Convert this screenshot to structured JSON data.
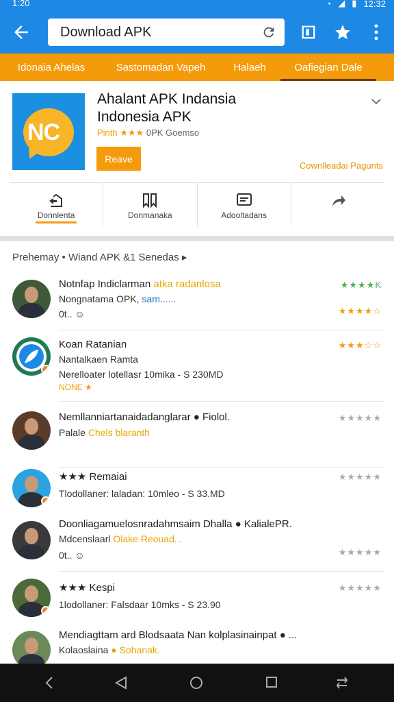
{
  "status_bar": {
    "time_left": "1:20",
    "time_right": "12:32"
  },
  "address": {
    "text": "Download APK"
  },
  "tabs": [
    {
      "label": "Idonaia Ahelas"
    },
    {
      "label": "Sastomadan Vapeh"
    },
    {
      "label": "Halaeh"
    },
    {
      "label": "Oafiegian Dale"
    }
  ],
  "app": {
    "icon_text": "NC",
    "title_line1": "Ahalant APK Indansia",
    "title_line2": "Indonesia APK",
    "meta_stars": "Pinth ★★★",
    "meta_info": "0PK Goemso",
    "remove_label": "Reave",
    "download_link": "Cownlleadai Pagunts"
  },
  "actions": [
    {
      "label": "Donnlenta"
    },
    {
      "label": "Donmanaka"
    },
    {
      "label": "Adooltadans"
    },
    {
      "label": ""
    }
  ],
  "list_header": "Prehemay • Wiand APK &1 Senedas ▸",
  "reviews": [
    {
      "line1": "Notnfap Indiclarman",
      "line1b": "atka radanlosa",
      "line2": "Nongnatama OPK,",
      "line2b": "sam......",
      "line3": "0t.. ☺",
      "right": "★★★★K",
      "right_color": "green",
      "right2": "★★★★☆"
    },
    {
      "line1": "Koan Ratanian",
      "line2": "Nantalkaen Ramta",
      "line3": "Nerelloater lotellasr 10mika - S 230MD",
      "line4": "NONE ★",
      "right": "★★★☆☆",
      "right_color": "orange"
    },
    {
      "line1": "Nemllanniartanaidadanglarar ● Fiolol.",
      "line2": "Palale",
      "line2b": "Chels blaranth",
      "right": "★★★★★",
      "right_color": "gray"
    },
    {
      "line1": "★★★ Remaiai",
      "line2": "Tlodollaner: laladan: 10mleo - S 33.MD",
      "right": "★★★★★",
      "right_color": "gray"
    },
    {
      "line1": "Doonliagamuelosnradahmsaim Dhalla ● KalialePR.",
      "line2": "Mdcenslaarl",
      "line2b": "Olake Reouad...",
      "line3": "0t.. ☺",
      "right": "",
      "right_color": "gray",
      "right2": "★★★★★"
    },
    {
      "line1": "★★★ Kespi",
      "line2": "1lodollaner: Falsdaar 10mks - S 23.90",
      "right": "★★★★★",
      "right_color": "gray"
    },
    {
      "line1": "Mendiagttam ard Blodsaata Nan kolplasinainpat ● ...",
      "line2": "Kolaoslaina",
      "line2b": "● Sohanak.",
      "right": "",
      "right_color": "gray"
    }
  ]
}
